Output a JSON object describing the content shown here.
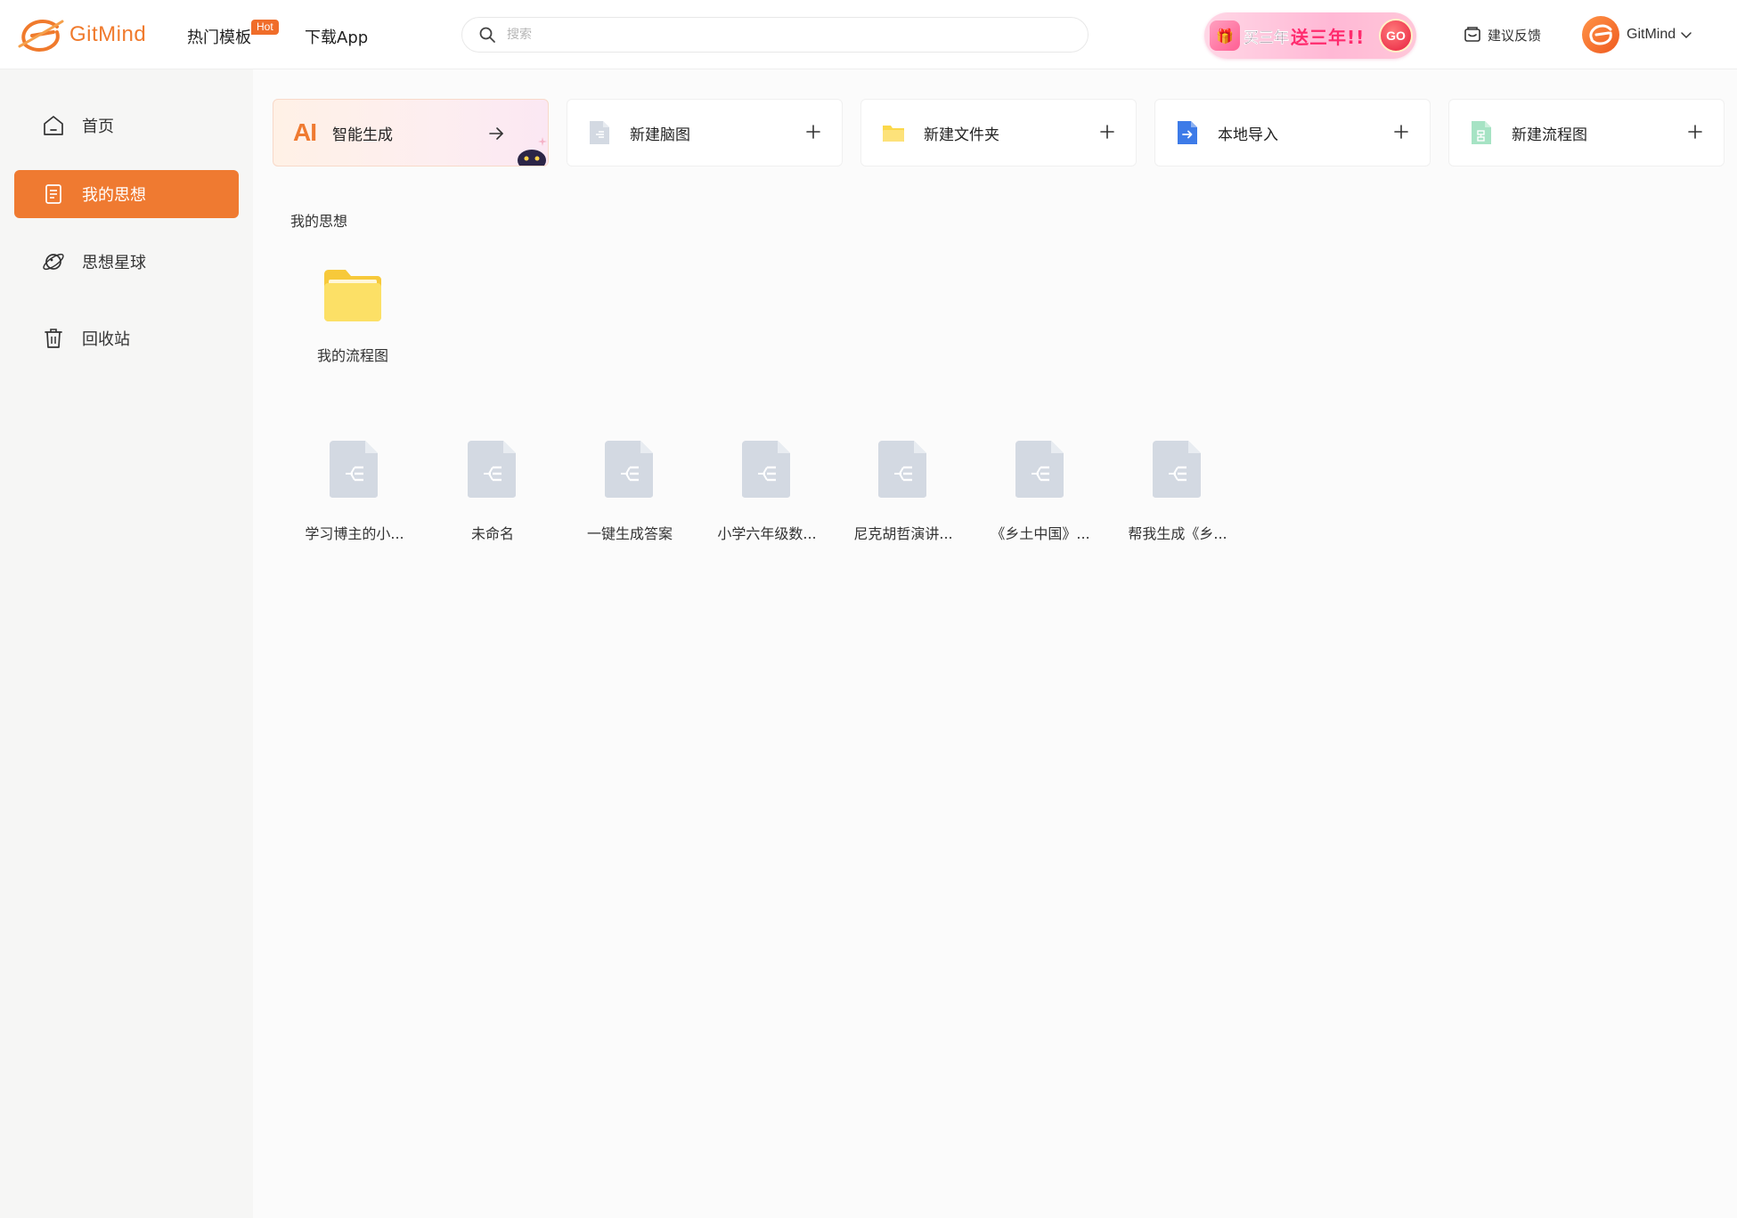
{
  "header": {
    "brand": "GitMind",
    "nav": [
      {
        "label": "热门模板",
        "badge": "Hot"
      },
      {
        "label": "下载App"
      }
    ],
    "search": {
      "placeholder": "搜索"
    },
    "promo": {
      "text_a": "买三年",
      "text_b": "送三年!!",
      "cta": "GO"
    },
    "feedback": "建议反馈",
    "user": {
      "name": "GitMind"
    }
  },
  "sidebar": {
    "items": [
      {
        "label": "首页",
        "icon": "home-icon",
        "active": false
      },
      {
        "label": "我的思想",
        "icon": "document-icon",
        "active": true
      },
      {
        "label": "思想星球",
        "icon": "planet-icon",
        "active": false
      },
      {
        "label": "回收站",
        "icon": "trash-icon",
        "active": false
      }
    ]
  },
  "quick_actions": [
    {
      "label": "智能生成",
      "icon": "ai-logo",
      "action": "arrow-right-icon"
    },
    {
      "label": "新建脑图",
      "icon": "mindmap-file-icon",
      "action": "plus-icon"
    },
    {
      "label": "新建文件夹",
      "icon": "folder-icon",
      "action": "plus-icon"
    },
    {
      "label": "本地导入",
      "icon": "import-icon",
      "action": "plus-icon"
    },
    {
      "label": "新建流程图",
      "icon": "flowchart-file-icon",
      "action": "plus-icon"
    }
  ],
  "ai_logo": "AI",
  "section_title": "我的思想",
  "folders": [
    {
      "name": "我的流程图"
    }
  ],
  "files": [
    {
      "name": "学习博主的小..."
    },
    {
      "name": "未命名"
    },
    {
      "name": "一键生成答案"
    },
    {
      "name": "小学六年级数..."
    },
    {
      "name": "尼克胡哲演讲..."
    },
    {
      "name": "《乡土中国》..."
    },
    {
      "name": "帮我生成《乡..."
    }
  ],
  "colors": {
    "accent": "#ef7a31",
    "hot_badge": "#f06d2a",
    "folder": "#fbd84a",
    "file_icon": "#d3d9e2"
  }
}
